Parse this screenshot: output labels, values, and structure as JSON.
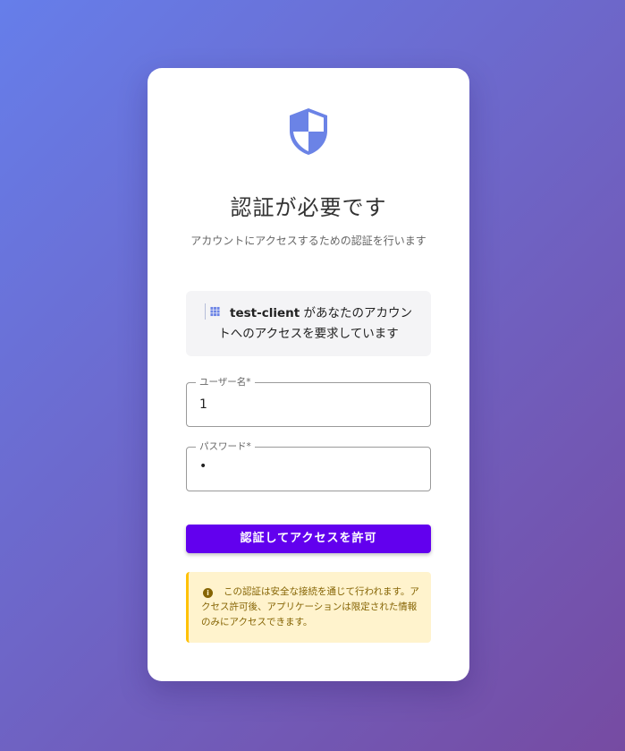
{
  "card": {
    "title": "認証が必要です",
    "subtitle": "アカウントにアクセスするための認証を行います"
  },
  "client": {
    "name": "test-client",
    "message": " があなたのアカウントへのアクセスを要求しています",
    "icon": "apps-grid-icon"
  },
  "form": {
    "username": {
      "label": "ユーザー名*",
      "value": "1"
    },
    "password": {
      "label": "パスワード*",
      "value": "•"
    },
    "submit_label": "認証してアクセスを許可"
  },
  "notice": {
    "icon": "info-icon",
    "text": "この認証は安全な接続を通じて行われます。アクセス許可後、アプリケーションは限定された情報のみにアクセスできます。"
  },
  "colors": {
    "background_start": "#667eea",
    "background_end": "#764ba2",
    "shield": "#6b83e6",
    "primary": "#6200ee",
    "notice_bg": "#fff3cd",
    "notice_border": "#ffc107",
    "notice_text": "#856404"
  }
}
